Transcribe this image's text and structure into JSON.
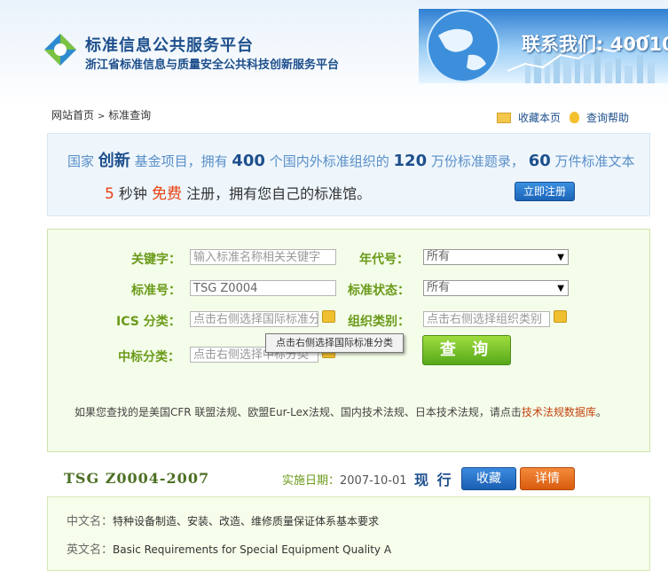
{
  "header": {
    "site_title": "标准信息公共服务平台",
    "site_subtitle": "浙江省标准信息与质量安全公共科技创新服务平台",
    "banner_text": "联系我们: 40010"
  },
  "breadcrumb": {
    "home": "网站首页",
    "sep": ">",
    "current": "标准查询"
  },
  "top_links": {
    "bookmark": "收藏本页",
    "help": "查询帮助"
  },
  "promo": {
    "p1": "国家",
    "p2": "创新",
    "p3": "基金项目，拥有",
    "p4": "400",
    "p5": "个国内外标准组织的",
    "p6": "120",
    "p7": "万份标准题录，",
    "p8": "60",
    "p9": "万件标准文本",
    "q1": "5",
    "q2": "秒钟",
    "q3": "免费",
    "q4": "注册，拥有您自己的标准馆。",
    "register": "立即注册"
  },
  "search": {
    "keyword_label": "关键字：",
    "keyword_placeholder": "输入标准名称相关关键字",
    "year_label": "年代号：",
    "year_value": "所有",
    "stdno_label": "标准号：",
    "stdno_value": "TSG Z0004",
    "status_label": "标准状态：",
    "status_value": "所有",
    "ics_label": "ICS 分类：",
    "ics_placeholder": "点击右侧选择国际标准分类",
    "org_label": "组织类别：",
    "org_placeholder": "点击右侧选择组织类别",
    "ccs_label": "中标分类：",
    "ccs_placeholder": "点击右侧选择中标分类",
    "tooltip": "点击右侧选择国际标准分类",
    "query_button": "查 询",
    "hint_prefix": "如果您查找的是美国CFR 联盟法规、欧盟Eur-Lex法规、国内技术法规、日本技术法规，请点击",
    "hint_link": "技术法规数据库",
    "hint_suffix": "。"
  },
  "result": {
    "code": "TSG Z0004-2007",
    "impl_label": "实施日期：",
    "impl_date": "2007-10-01",
    "status": "现 行",
    "favorite": "收藏",
    "detail": "详情",
    "cn_label": "中文名：",
    "cn_name": "特种设备制造、安装、改造、维修质量保证体系基本要求",
    "en_label": "英文名：",
    "en_name": "Basic Requirements for Special Equipment Quality A"
  }
}
